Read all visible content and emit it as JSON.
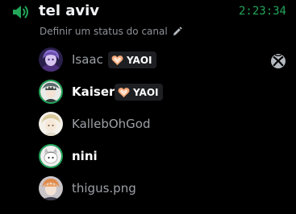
{
  "channel": {
    "icon": "speaker-icon",
    "name": "tel aviv",
    "timer": "2:23:34",
    "status_placeholder": "Definir um status do canal",
    "status_icon": "pencil-icon"
  },
  "tag": {
    "label": "YAOI",
    "icon": "heart-icon"
  },
  "members": [
    {
      "name": "Isaac",
      "speaking": false,
      "has_tag": true,
      "activity_icon": "xbox-icon"
    },
    {
      "name": "Kaiser",
      "speaking": true,
      "has_tag": true
    },
    {
      "name": "KallebOhGod",
      "speaking": false,
      "has_tag": false
    },
    {
      "name": "nini",
      "speaking": true,
      "has_tag": false
    },
    {
      "name": "thigus.png",
      "speaking": false,
      "has_tag": false
    }
  ],
  "colors": {
    "speaking_ring": "#23a55a",
    "timer": "#23a55a",
    "muted_name": "#9ca0a6",
    "active_name": "#ffffff",
    "tag_heart": "#f5a97a"
  }
}
